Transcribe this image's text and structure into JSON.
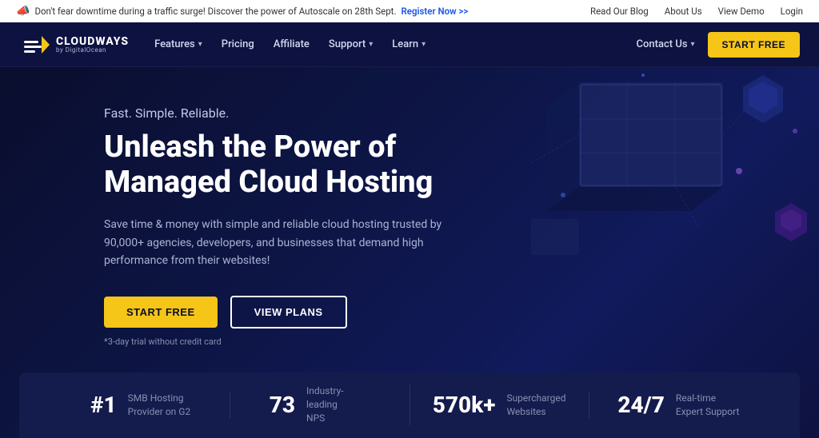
{
  "announcement": {
    "icon": "📣",
    "text": "Don't fear downtime during a traffic surge! Discover the power of Autoscale on 28th Sept.",
    "link_text": "Register Now >>",
    "right_links": [
      "Read Our Blog",
      "About Us",
      "View Demo",
      "Login"
    ]
  },
  "navbar": {
    "logo_name": "CLOUDWAYS",
    "logo_sub": "by DigitalOcean",
    "nav_items": [
      {
        "label": "Features",
        "has_dropdown": true
      },
      {
        "label": "Pricing",
        "has_dropdown": false
      },
      {
        "label": "Affiliate",
        "has_dropdown": false
      },
      {
        "label": "Support",
        "has_dropdown": true
      },
      {
        "label": "Learn",
        "has_dropdown": true
      }
    ],
    "contact_us": "Contact Us",
    "start_free": "START FREE"
  },
  "hero": {
    "subtitle": "Fast. Simple. Reliable.",
    "title": "Unleash the Power of\nManaged Cloud Hosting",
    "description": "Save time & money with simple and reliable cloud hosting trusted by 90,000+ agencies, developers, and businesses that demand high performance from their websites!",
    "btn_primary": "START FREE",
    "btn_secondary": "VIEW PLANS",
    "trial_note": "*3-day trial without credit card"
  },
  "stats": [
    {
      "number": "#1",
      "desc": "SMB Hosting\nProvider on G2"
    },
    {
      "number": "73",
      "desc": "Industry-leading\nNPS"
    },
    {
      "number": "570k+",
      "desc": "Supercharged\nWebsites"
    },
    {
      "number": "24/7",
      "desc": "Real-time\nExpert Support"
    }
  ]
}
